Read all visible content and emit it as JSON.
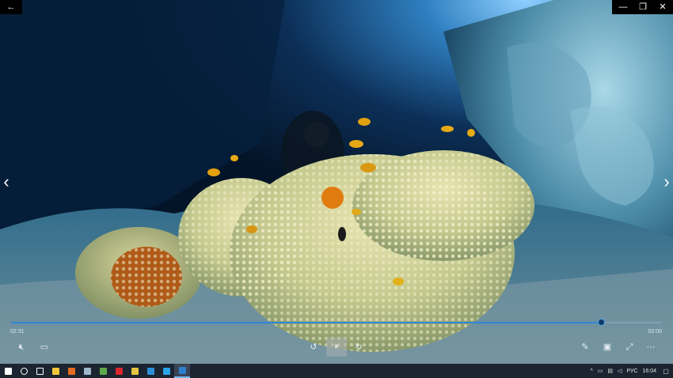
{
  "window": {
    "back_icon": "arrow-left-icon",
    "minimize_icon": "minimize-icon",
    "maximize_icon": "maximize-icon",
    "close_icon": "close-icon"
  },
  "glyphs": {
    "back": "←",
    "minimize": "—",
    "maximize": "❐",
    "close": "✕",
    "prev": "‹",
    "next": "›",
    "mute": "🔇︎",
    "caption": "▭",
    "rewind": "↺",
    "pause": "⏸︎",
    "forward": "↻",
    "edit": "✎",
    "miniview": "▣",
    "fullscreen": "⤢",
    "more": "⋯",
    "search": "⚲",
    "task_view": "⧉",
    "notification": "▢"
  },
  "player": {
    "time_elapsed": "02:31",
    "time_total": "02:00",
    "progress_fraction": 0.906
  },
  "taskbar": {
    "apps": [
      {
        "name": "windows-start-icon",
        "color": "#ffffff"
      },
      {
        "name": "search-icon",
        "color": "#ffffff"
      },
      {
        "name": "task-view-icon",
        "color": "#ffffff"
      },
      {
        "name": "file-explorer-icon",
        "color": "#f3c53d"
      },
      {
        "name": "firefox-icon",
        "color": "#e66b22"
      },
      {
        "name": "app-icon",
        "color": "#9cb8cc"
      },
      {
        "name": "app-icon-green",
        "color": "#5fa84a"
      },
      {
        "name": "opera-icon",
        "color": "#d9262e"
      },
      {
        "name": "chrome-icon",
        "color": "#e4c441"
      },
      {
        "name": "edge-icon",
        "color": "#2c8fd8"
      },
      {
        "name": "skype-icon",
        "color": "#2aa4e8"
      },
      {
        "name": "movies-tv-icon",
        "color": "#2f7fd0"
      }
    ],
    "lang": "РУС",
    "clock": "16:04"
  },
  "colors": {
    "accent": "#2f86d6",
    "taskbar": "#1b2430"
  }
}
